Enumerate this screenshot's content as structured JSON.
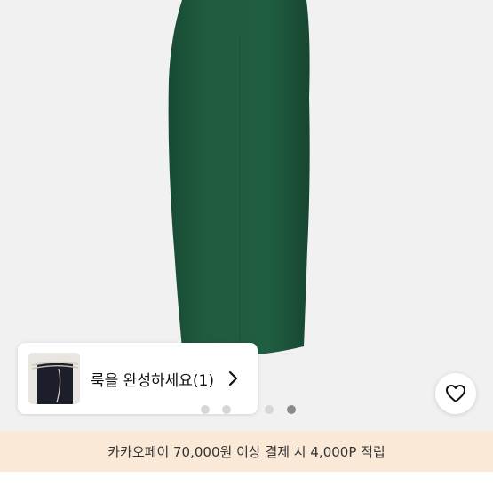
{
  "product": {
    "image_alt": "green pencil skirt",
    "skirt_color": "#1f5b3f",
    "background_color": "#f1f1f1"
  },
  "look_card": {
    "label": "룩을 완성하세요(1)",
    "thumbnail_icon": "chain-belt-thumbnail",
    "chevron_icon": "chevron-right-icon"
  },
  "wishlist": {
    "icon": "heart-icon"
  },
  "pager": {
    "total_visible": 4,
    "active_index": 3,
    "active_color": "#8a8a8a",
    "inactive_color": "#d6d6d6"
  },
  "promo": {
    "text": "카카오페이 70,000원 이상 결제 시 4,000P 적립",
    "background": "#fbe9d8"
  }
}
